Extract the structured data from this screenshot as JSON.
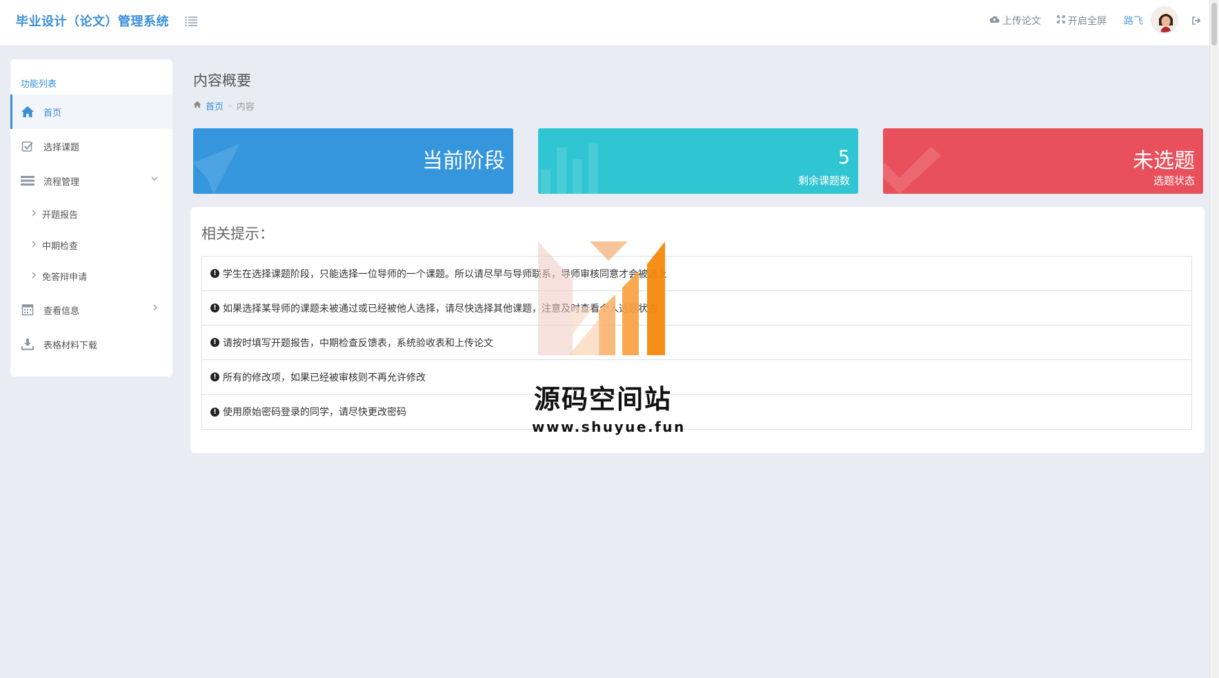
{
  "app": {
    "title": "毕业设计（论文）管理系统"
  },
  "topbar": {
    "upload_label": "上传论文",
    "fullscreen_label": "开启全屏",
    "user_name": "路飞"
  },
  "sidebar": {
    "title": "功能列表",
    "items": [
      {
        "label": "首页",
        "icon": "home-icon",
        "active": true
      },
      {
        "label": "选择课题",
        "icon": "checkbox-icon"
      },
      {
        "label": "流程管理",
        "icon": "list-icon",
        "expanded": true
      },
      {
        "label": "查看信息",
        "icon": "calendar-icon"
      },
      {
        "label": "表格材料下载",
        "icon": "download-icon"
      }
    ],
    "sub_items": [
      {
        "label": "开题报告"
      },
      {
        "label": "中期检查"
      },
      {
        "label": "免答辩申请"
      }
    ]
  },
  "page": {
    "title": "内容概要",
    "breadcrumb": {
      "home": "首页",
      "current": "内容"
    }
  },
  "stats": {
    "stage": {
      "value": "当前阶段",
      "color": "#3596dd"
    },
    "remaining": {
      "value": "5",
      "label": "剩余课题数",
      "color": "#30c5d2"
    },
    "status": {
      "value": "未选题",
      "label": "选题状态",
      "color": "#e8505c"
    }
  },
  "tips": {
    "heading": "相关提示：",
    "items": [
      "学生在选择课题阶段，只能选择一位导师的一个课题。所以请尽早与导师联系，导师审核同意才会被选上",
      "如果选择某导师的课题未被通过或已经被他人选择，请尽快选择其他课题，注意及时查看个人选题状态",
      "请按时填写开题报告，中期检查反馈表，系统验收表和上传论文",
      "所有的修改项，如果已经被审核则不再允许修改",
      "使用原始密码登录的同学，请尽快更改密码"
    ]
  },
  "watermark": {
    "title": "源码空间站",
    "url": "www.shuyue.fun"
  }
}
